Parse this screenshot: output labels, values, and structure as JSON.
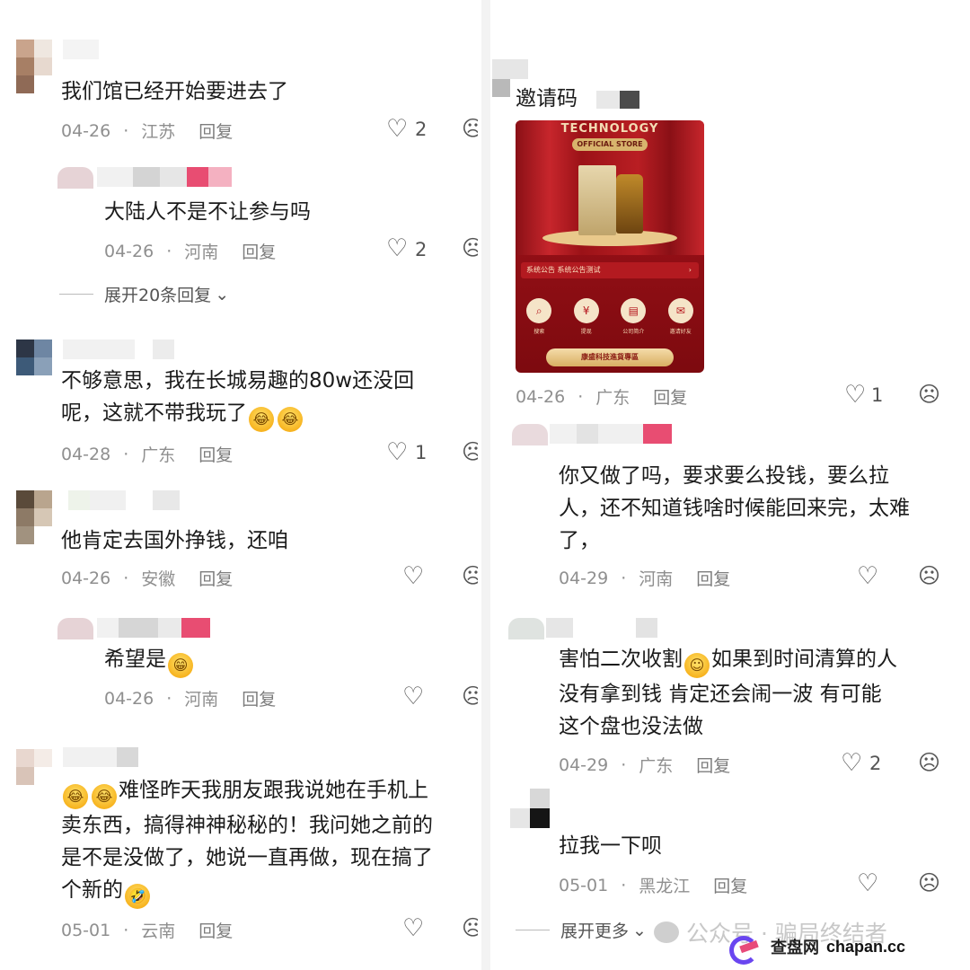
{
  "left_comments": [
    {
      "text": "我们馆已经开始要进去了",
      "date": "04-26",
      "region": "江苏",
      "reply": "回复",
      "likes": "2"
    },
    {
      "text": "大陆人不是不让参与吗",
      "date": "04-26",
      "region": "河南",
      "reply": "回复",
      "likes": "2"
    },
    {
      "text_line1": "不够意思，我在长城易趣的80w还没回",
      "text_line2": "呢，这就不带我玩了",
      "date": "04-28",
      "region": "广东",
      "reply": "回复",
      "likes": "1"
    },
    {
      "text": "他肯定去国外挣钱，还咱",
      "date": "04-26",
      "region": "安徽",
      "reply": "回复"
    },
    {
      "text": "希望是",
      "date": "04-26",
      "region": "河南",
      "reply": "回复"
    },
    {
      "text_line1": "难怪昨天我朋友跟我说她在手机上",
      "text_line2": "卖东西，搞得神神秘秘的！我问她之前的",
      "text_line3": "是不是没做了，她说一直再做，现在搞了",
      "text_line4": "个新的",
      "date": "05-01",
      "region": "云南",
      "reply": "回复"
    }
  ],
  "left_expand": "展开20条回复",
  "right_comments": [
    {
      "text": "邀请码",
      "date": "04-26",
      "region": "广东",
      "reply": "回复",
      "likes": "1"
    },
    {
      "text_line1": "你又做了吗，要求要么投钱，要么拉",
      "text_line2": "人，还不知道钱啥时候能回来完，太难",
      "text_line3": "了，",
      "date": "04-29",
      "region": "河南",
      "reply": "回复"
    },
    {
      "text_line1a": "害怕二次收割",
      "text_line1b": "如果到时间清算的人",
      "text_line2": "没有拿到钱   肯定还会闹一波  有可能",
      "text_line3": "这个盘也没法做",
      "date": "04-29",
      "region": "广东",
      "reply": "回复",
      "likes": "2"
    },
    {
      "text": "拉我一下呗",
      "date": "05-01",
      "region": "黑龙江",
      "reply": "回复"
    }
  ],
  "right_expand": "展开更多",
  "invite_image": {
    "brand": "TECHNOLOGY",
    "store": "OFFICIAL STORE",
    "notice": "系统公告  系统公告测试",
    "icons": [
      "搜索",
      "提现",
      "公司简介",
      "邀请好友"
    ],
    "button": "康盛科技進貨專區"
  },
  "watermark": {
    "text": "公众号 · 骗局终结者",
    "logo_cn": "查盘网",
    "logo_en": "chapan.cc"
  },
  "colors": {
    "meta_gray": "#8f8f8f",
    "text": "#1b1b1b",
    "divider": "#f3f3f3"
  }
}
